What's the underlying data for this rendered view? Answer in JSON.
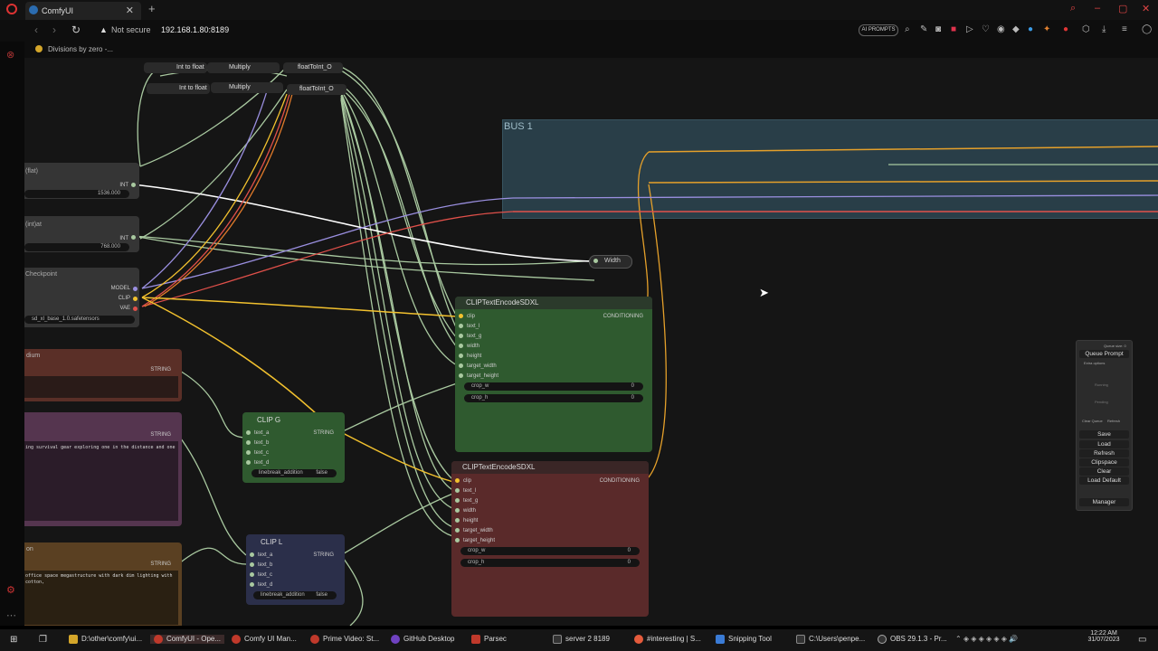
{
  "browser": {
    "tab_title": "ComfyUI",
    "not_secure": "Not secure",
    "url": "192.168.1.80:8189",
    "ai_badge": "AI PROMPTS",
    "bookmark": "Divisions by zero -..."
  },
  "nodes": {
    "int_to_float_1": "Int to float",
    "int_to_float_2": "Int to float",
    "multiply_1": "Multiply",
    "multiply_2": "Multiply",
    "float_to_int_1": "floatToInt_O",
    "float_to_int_2": "floatToInt_O",
    "bus_title": "BUS 1",
    "width_reroute": "Width",
    "left_node_1_title": "(flat)",
    "left_node_1_value": "1536.000",
    "left_node_1_output": "INT",
    "left_node_2_title": "(int)at",
    "left_node_2_value": "768.000",
    "left_node_2_output": "INT",
    "checkpoint_title": "Checkpoint",
    "checkpoint_model": "MODEL",
    "checkpoint_clip": "CLIP",
    "checkpoint_vae": "VAE",
    "checkpoint_file": "sd_xl_base_1.0.safetensors",
    "string_node_1_title": "dium",
    "string_node_1_output": "STRING",
    "string_node_2_output": "STRING",
    "string_node_2_text": "ing survival gear exploring one in the distance and one",
    "string_node_3_title": "on",
    "string_node_3_output": "STRING",
    "string_node_3_text": "office space megastructure with dark dim lighting with cotton,",
    "clip_g_title": "CLIP G",
    "clip_l_title": "CLIP L",
    "clip_string": "STRING",
    "clip_inputs": [
      "text_a",
      "text_b",
      "text_c",
      "text_d"
    ],
    "linebreak_label": "linebreak_addition",
    "linebreak_value": "false",
    "encode_title": "CLIPTextEncodeSDXL",
    "encode_output": "CONDITIONING",
    "encode_inputs": [
      "clip",
      "text_l",
      "text_g",
      "width",
      "height",
      "target_width",
      "target_height"
    ],
    "crop_w": "crop_w",
    "crop_h": "crop_h",
    "crop_value": "0"
  },
  "queue": {
    "queue_size": "Queue size: 0",
    "queue_prompt": "Queue Prompt",
    "extra_options": "Extra options",
    "running": "Running",
    "pending": "Pending",
    "clear_queue": "Clear Queue",
    "refresh_small": "Refresh",
    "buttons": [
      "Save",
      "Load",
      "Refresh",
      "Clipspace",
      "Clear",
      "Load Default"
    ],
    "manager": "Manager"
  },
  "taskbar": [
    {
      "label": "D:\\other\\comfy\\ui...",
      "color": "#d4a62a"
    },
    {
      "label": "ComfyUI - Ope...",
      "color": "#c0392b"
    },
    {
      "label": "Comfy UI Man...",
      "color": "#c0392b"
    },
    {
      "label": "Prime Video: St...",
      "color": "#c0392b"
    },
    {
      "label": "GitHub Desktop",
      "color": "#6f42c1"
    },
    {
      "label": "Parsec",
      "color": "#c0392b"
    },
    {
      "label": "server 2 8189",
      "color": "#333333"
    },
    {
      "label": "#interesting | S...",
      "color": "#e55b3c"
    },
    {
      "label": "Snipping Tool",
      "color": "#3a7bd5"
    },
    {
      "label": "C:\\Users\\penpe...",
      "color": "#333333"
    },
    {
      "label": "OBS 29.1.3 - Pr...",
      "color": "#333333"
    }
  ],
  "clock": {
    "time": "12:22 AM",
    "date": "31/07/2023"
  },
  "colors": {
    "canvas": "#151515",
    "bus_group": "#2d4652",
    "green_node": "#2f5a2f",
    "red_node": "#5a2a2a",
    "purple_node": "#55354f",
    "blue_node": "#2b2f4a",
    "yellow_wire": "#f2c12e",
    "red_wire": "#e0504a",
    "purple_wire": "#9a8fe0",
    "green_wire": "#a9c9a0",
    "white_wire": "#ffffff"
  }
}
